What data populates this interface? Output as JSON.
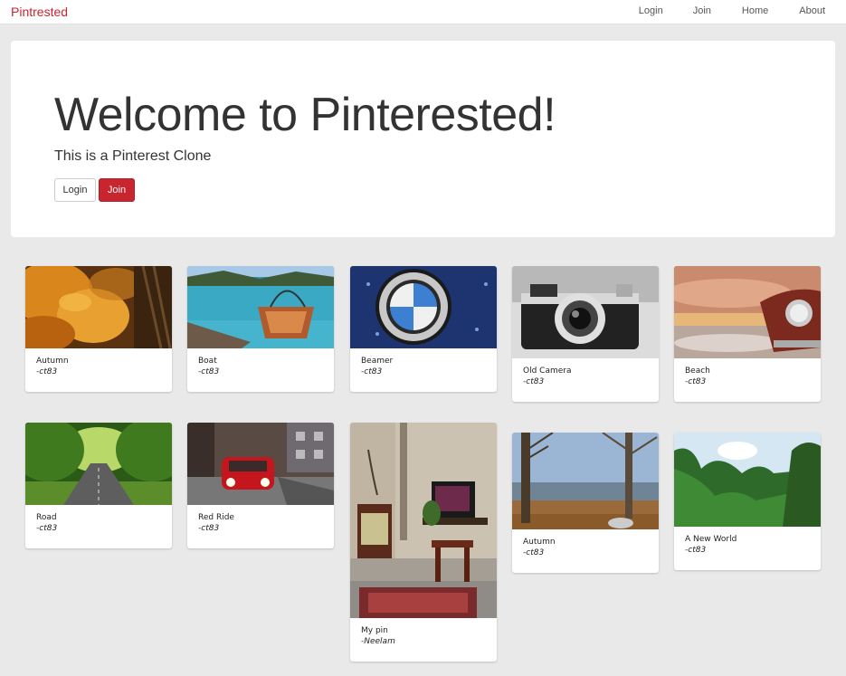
{
  "navbar": {
    "brand": "Pintrested",
    "links": [
      "Login",
      "Join",
      "Home",
      "About"
    ]
  },
  "hero": {
    "title": "Welcome to Pinterested!",
    "subtitle": "This is a Pinterest Clone",
    "login_button": "Login",
    "join_button": "Join"
  },
  "pins": [
    {
      "title": "Autumn",
      "author": "-ct83",
      "image": "autumn-leaves-photo"
    },
    {
      "title": "Boat",
      "author": "-ct83",
      "image": "boat-on-lake-photo"
    },
    {
      "title": "Beamer",
      "author": "-ct83",
      "image": "bmw-emblem-photo"
    },
    {
      "title": "Old Camera",
      "author": "-ct83",
      "image": "old-camera-photo"
    },
    {
      "title": "Beach",
      "author": "-ct83",
      "image": "beach-sunset-car-photo"
    },
    {
      "title": "Road",
      "author": "-ct83",
      "image": "tree-lined-road-photo"
    },
    {
      "title": "Red Ride",
      "author": "-ct83",
      "image": "red-car-street-photo"
    },
    {
      "title": "My pin",
      "author": "-Neelam",
      "image": "living-room-tv-photo"
    },
    {
      "title": "Autumn",
      "author": "-ct83",
      "image": "bare-trees-landscape-photo"
    },
    {
      "title": "A New World",
      "author": "-ct83",
      "image": "green-mountains-photo"
    }
  ]
}
